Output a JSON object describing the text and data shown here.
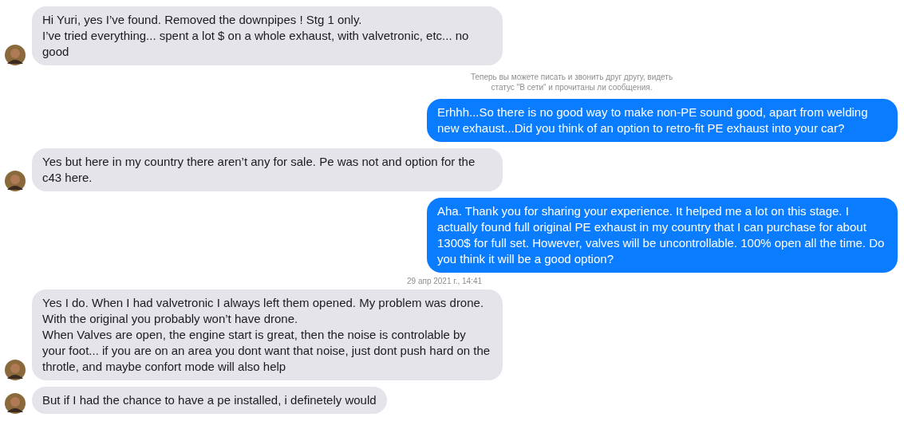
{
  "messages": [
    {
      "kind": "incoming",
      "text": "Hi Yuri, yes I’ve found. Removed the downpipes ! Stg 1 only.\nI’ve tried everything... spent a lot $ on a whole exhaust, with valvetronic, etc... no good"
    },
    {
      "kind": "notice",
      "text": "Теперь вы можете писать и звонить друг другу, видеть статус \"В сети\" и прочитаны ли сообщения."
    },
    {
      "kind": "outgoing",
      "text": "Erhhh...So there is no good way to make non-PE sound good, apart from welding new exhaust...Did you think of an option to retro-fit PE exhaust into your car?"
    },
    {
      "kind": "incoming",
      "text": "Yes but here in my country there aren’t any for sale. Pe was not and option for the c43 here."
    },
    {
      "kind": "outgoing",
      "text": "Aha. Thank you for sharing your experience. It helped me a lot on this stage. I actually found full original PE exhaust in my country that I can purchase for about 1300$ for full set. However, valves will be uncontrollable. 100% open all the time. Do you think it will be a good option?"
    },
    {
      "kind": "timestamp",
      "text": "29 апр 2021 г., 14:41"
    },
    {
      "kind": "incoming",
      "text": "Yes I do. When I had valvetronic I always left them opened. My problem was drone.\nWith the original you probably won’t have drone.\nWhen Valves are open, the engine start is great, then the noise is controlable by your foot... if you are on an area you dont want that noise, just dont push hard on the throtle, and maybe confort mode will also help"
    },
    {
      "kind": "incoming",
      "text": "But if I had the chance to have a pe installed, i definetely would"
    }
  ]
}
